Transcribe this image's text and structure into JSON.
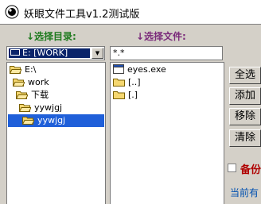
{
  "window": {
    "title": "妖眼文件工具v1.2测试版"
  },
  "left": {
    "heading": "↓选择目录:",
    "drive": "E: [WORK]",
    "tree": [
      {
        "label": "E:\\",
        "selected": false,
        "open": true
      },
      {
        "label": "work",
        "selected": false,
        "open": true
      },
      {
        "label": "下载",
        "selected": false,
        "open": true
      },
      {
        "label": "yywjgj",
        "selected": false,
        "open": true
      },
      {
        "label": "yywjgj",
        "selected": true,
        "open": true
      }
    ]
  },
  "right": {
    "heading": "↓选择文件:",
    "filter": "*.*",
    "files": [
      {
        "label": "eyes.exe",
        "type": "exe"
      },
      {
        "label": "[..]",
        "type": "folder"
      },
      {
        "label": "[.]",
        "type": "folder"
      }
    ]
  },
  "buttons": {
    "select_all": "全选",
    "add": "添加",
    "remove": "移除",
    "clear": "清除"
  },
  "backup_label": "备份",
  "current_label": "当前有"
}
